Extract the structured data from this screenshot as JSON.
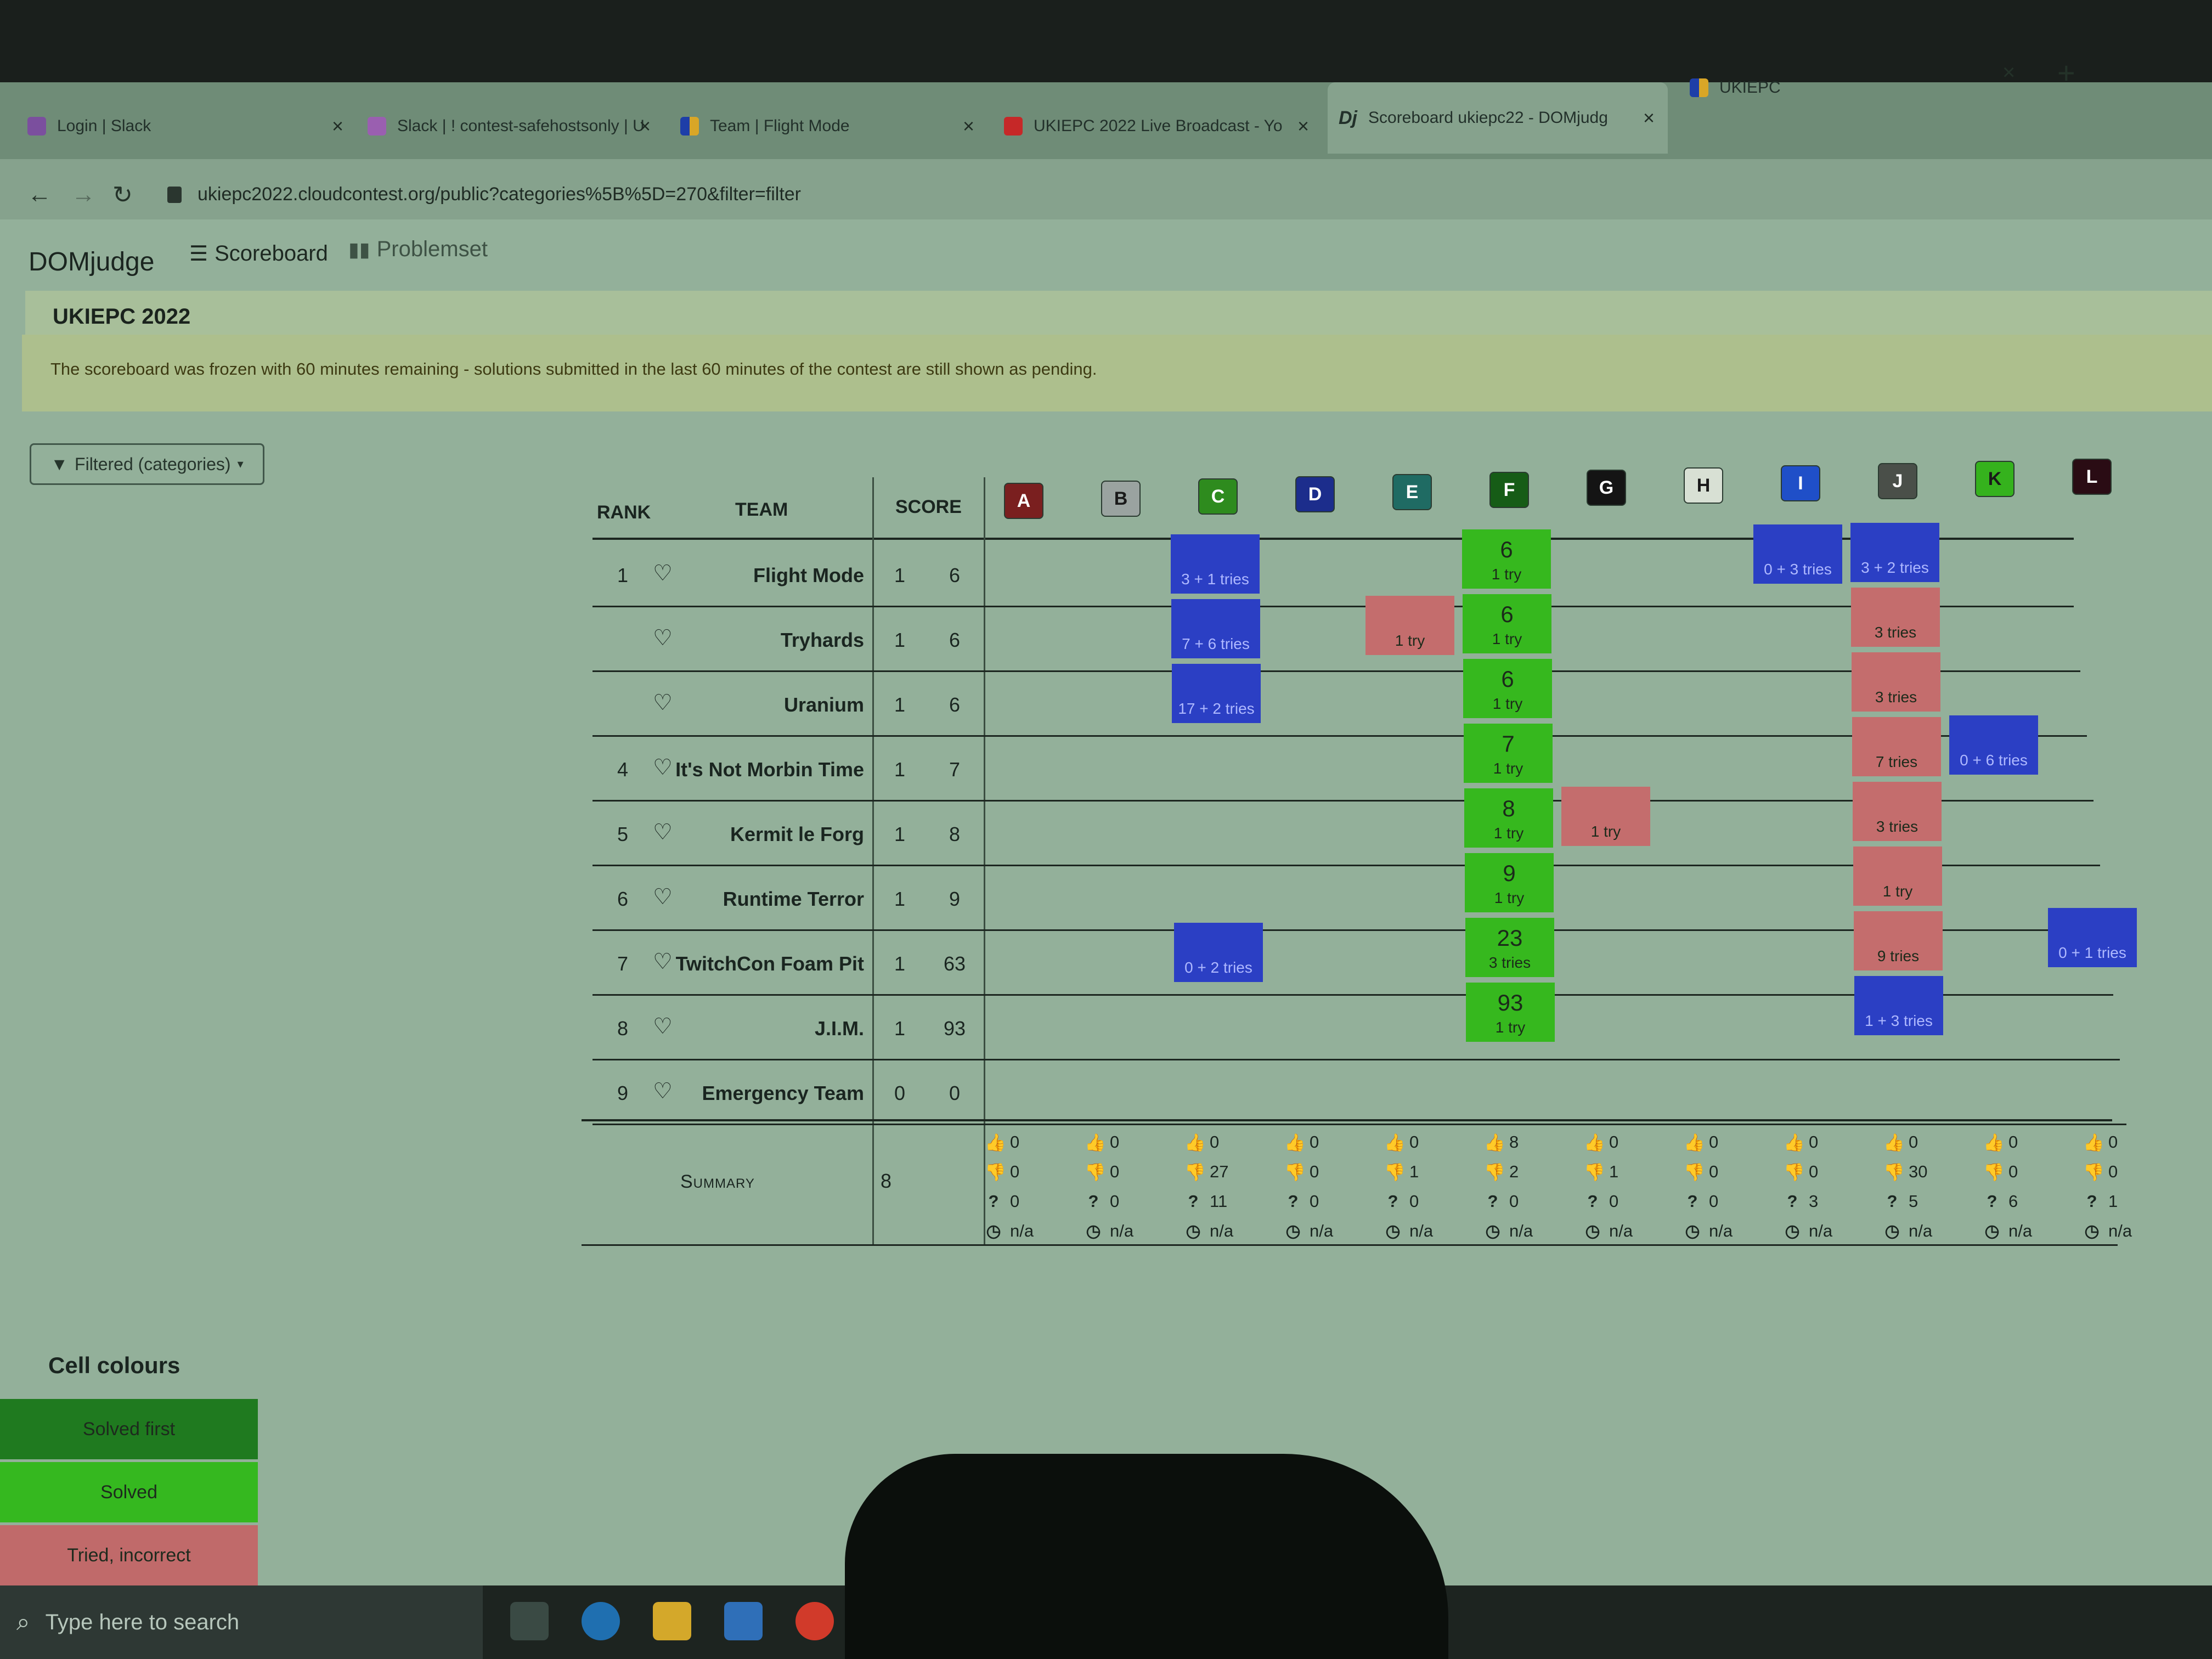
{
  "browser": {
    "tabs": [
      {
        "title": "Login | Slack",
        "icon": "slack-icon"
      },
      {
        "title": "Slack | ! contest-safehostsonly | U",
        "icon": "slack-icon"
      },
      {
        "title": "Team | Flight Mode",
        "icon": "ukiepc-icon"
      },
      {
        "title": "UKIEPC 2022 Live Broadcast - Yo",
        "icon": "youtube-icon"
      },
      {
        "title": "Scoreboard ukiepc22 - DOMjudg",
        "icon": "domjudge-icon",
        "active": true
      },
      {
        "title": "UKIEPC",
        "icon": "ukiepc-icon"
      }
    ],
    "url": "ukiepc2022.cloudcontest.org/public?categories%5B%5D=270&filter=filter"
  },
  "navbar": {
    "brand": "DOMjudge",
    "scoreboard": "Scoreboard",
    "problemset": "Problemset"
  },
  "contest": {
    "title": "UKIEPC 2022"
  },
  "frozen_notice": "The scoreboard was frozen with 60 minutes remaining - solutions submitted in the last 60 minutes of the contest are still shown as pending.",
  "filter": {
    "label": "Filtered (categories)"
  },
  "table": {
    "headers": {
      "rank": "RANK",
      "team": "TEAM",
      "score": "SCORE"
    },
    "problems": [
      {
        "label": "A",
        "color": "#7a1f1f",
        "text": "#ffffff"
      },
      {
        "label": "B",
        "color": "#9aa3a0",
        "text": "#1a1a1a"
      },
      {
        "label": "C",
        "color": "#2e8b1e",
        "text": "#ffffff"
      },
      {
        "label": "D",
        "color": "#1c2d8c",
        "text": "#ffffff"
      },
      {
        "label": "E",
        "color": "#1f6b63",
        "text": "#ffffff"
      },
      {
        "label": "F",
        "color": "#165c16",
        "text": "#ffffff"
      },
      {
        "label": "G",
        "color": "#141414",
        "text": "#ffffff"
      },
      {
        "label": "H",
        "color": "#d8e0d4",
        "text": "#1a1a1a"
      },
      {
        "label": "I",
        "color": "#1f4fc8",
        "text": "#ffffff"
      },
      {
        "label": "J",
        "color": "#4a4f49",
        "text": "#ffffff"
      },
      {
        "label": "K",
        "color": "#35b21d",
        "text": "#1a1a1a"
      },
      {
        "label": "L",
        "color": "#2a0c14",
        "text": "#ffffff"
      }
    ],
    "rows": [
      {
        "rank": "1",
        "team": "Flight Mode",
        "solved": "1",
        "time": "6",
        "cells": [
          null,
          null,
          {
            "s": "pending",
            "t": "3 + 1 tries"
          },
          null,
          null,
          {
            "s": "solved",
            "time": "6",
            "t": "1 try"
          },
          null,
          null,
          {
            "s": "pending",
            "t": "0 + 3 tries"
          },
          {
            "s": "pending",
            "t": "3 + 2 tries"
          },
          null,
          null
        ]
      },
      {
        "rank": "",
        "team": "Tryhards",
        "solved": "1",
        "time": "6",
        "cells": [
          null,
          null,
          {
            "s": "pending",
            "t": "7 + 6 tries"
          },
          null,
          {
            "s": "wrong",
            "t": "1 try"
          },
          {
            "s": "solved",
            "time": "6",
            "t": "1 try"
          },
          null,
          null,
          null,
          {
            "s": "wrong",
            "t": "3 tries"
          },
          null,
          null
        ]
      },
      {
        "rank": "",
        "team": "Uranium",
        "solved": "1",
        "time": "6",
        "cells": [
          null,
          null,
          {
            "s": "pending",
            "t": "17 + 2 tries"
          },
          null,
          null,
          {
            "s": "solved",
            "time": "6",
            "t": "1 try"
          },
          null,
          null,
          null,
          {
            "s": "wrong",
            "t": "3 tries"
          },
          null,
          null
        ]
      },
      {
        "rank": "4",
        "team": "It's Not Morbin Time",
        "solved": "1",
        "time": "7",
        "cells": [
          null,
          null,
          null,
          null,
          null,
          {
            "s": "solved",
            "time": "7",
            "t": "1 try"
          },
          null,
          null,
          null,
          {
            "s": "wrong",
            "t": "7 tries"
          },
          {
            "s": "pending",
            "t": "0 + 6 tries"
          },
          null
        ]
      },
      {
        "rank": "5",
        "team": "Kermit le Forg",
        "solved": "1",
        "time": "8",
        "cells": [
          null,
          null,
          null,
          null,
          null,
          {
            "s": "solved",
            "time": "8",
            "t": "1 try"
          },
          {
            "s": "wrong",
            "t": "1 try"
          },
          null,
          null,
          {
            "s": "wrong",
            "t": "3 tries"
          },
          null,
          null
        ]
      },
      {
        "rank": "6",
        "team": "Runtime Terror",
        "solved": "1",
        "time": "9",
        "cells": [
          null,
          null,
          null,
          null,
          null,
          {
            "s": "solved",
            "time": "9",
            "t": "1 try"
          },
          null,
          null,
          null,
          {
            "s": "wrong",
            "t": "1 try"
          },
          null,
          null
        ]
      },
      {
        "rank": "7",
        "team": "TwitchCon Foam Pit",
        "solved": "1",
        "time": "63",
        "cells": [
          null,
          null,
          {
            "s": "pending",
            "t": "0 + 2 tries"
          },
          null,
          null,
          {
            "s": "solved",
            "time": "23",
            "t": "3 tries"
          },
          null,
          null,
          null,
          {
            "s": "wrong",
            "t": "9 tries"
          },
          null,
          {
            "s": "pending",
            "t": "0 + 1 tries"
          }
        ]
      },
      {
        "rank": "8",
        "team": "J.I.M.",
        "solved": "1",
        "time": "93",
        "cells": [
          null,
          null,
          null,
          null,
          null,
          {
            "s": "solved",
            "time": "93",
            "t": "1 try"
          },
          null,
          null,
          null,
          {
            "s": "pending",
            "t": "1 + 3 tries"
          },
          null,
          null
        ]
      },
      {
        "rank": "9",
        "team": "Emergency Team",
        "solved": "0",
        "time": "0",
        "cells": [
          null,
          null,
          null,
          null,
          null,
          null,
          null,
          null,
          null,
          null,
          null,
          null
        ]
      }
    ],
    "summary": {
      "label": "Summary",
      "total": "8",
      "per_problem": [
        {
          "correct": "0",
          "incorrect": "0",
          "pending": "0",
          "first": "n/a"
        },
        {
          "correct": "0",
          "incorrect": "0",
          "pending": "0",
          "first": "n/a"
        },
        {
          "correct": "0",
          "incorrect": "27",
          "pending": "11",
          "first": "n/a"
        },
        {
          "correct": "0",
          "incorrect": "0",
          "pending": "0",
          "first": "n/a"
        },
        {
          "correct": "0",
          "incorrect": "1",
          "pending": "0",
          "first": "n/a"
        },
        {
          "correct": "8",
          "incorrect": "2",
          "pending": "0",
          "first": "n/a"
        },
        {
          "correct": "0",
          "incorrect": "1",
          "pending": "0",
          "first": "n/a"
        },
        {
          "correct": "0",
          "incorrect": "0",
          "pending": "0",
          "first": "n/a"
        },
        {
          "correct": "0",
          "incorrect": "0",
          "pending": "3",
          "first": "n/a"
        },
        {
          "correct": "0",
          "incorrect": "30",
          "pending": "5",
          "first": "n/a"
        },
        {
          "correct": "0",
          "incorrect": "0",
          "pending": "6",
          "first": "n/a"
        },
        {
          "correct": "0",
          "incorrect": "0",
          "pending": "1",
          "first": "n/a"
        }
      ]
    }
  },
  "legend": {
    "title": "Cell colours",
    "items": [
      {
        "label": "Solved first",
        "color": "#1f7a1f"
      },
      {
        "label": "Solved",
        "color": "#35b81f"
      },
      {
        "label": "Tried, incorrect",
        "color": "#c06a6a"
      }
    ]
  },
  "status_colors": {
    "solved": "#36b81e",
    "wrong": "#c46d6d",
    "pending": "#2b3fc4"
  },
  "taskbar": {
    "search_placeholder": "Type here to search"
  }
}
